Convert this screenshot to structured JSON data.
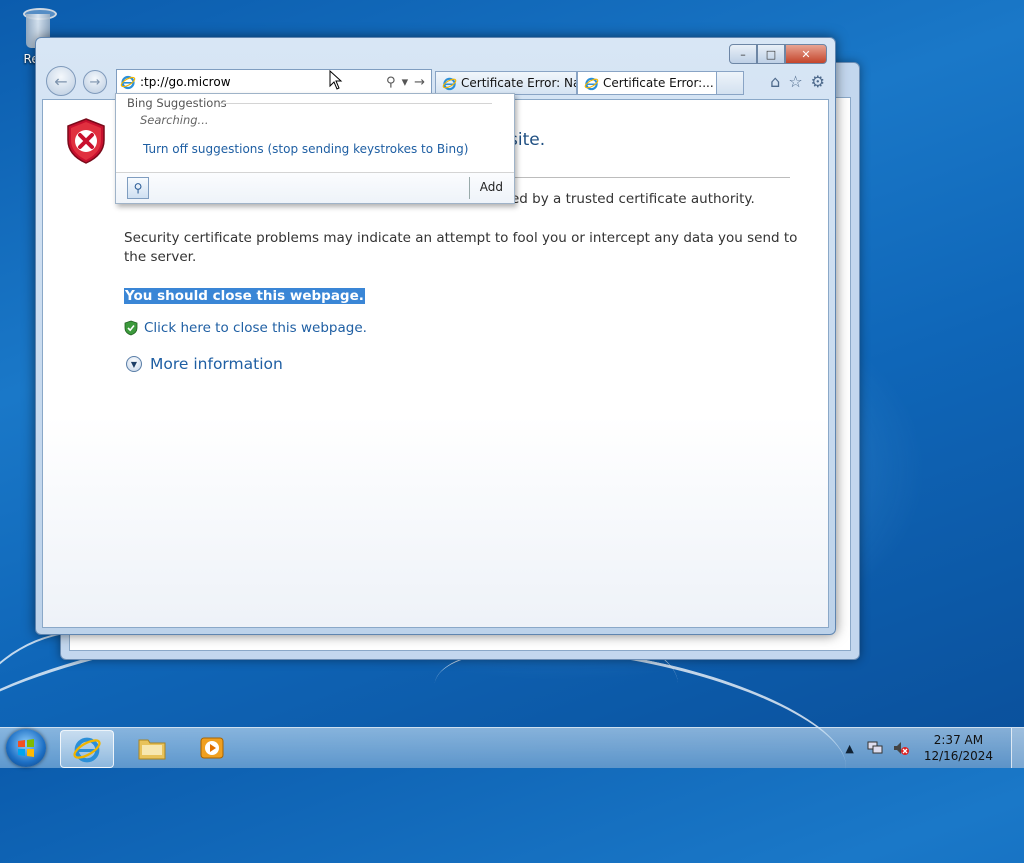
{
  "desktop": {
    "recycle_bin_label": "Recy"
  },
  "browser": {
    "address_url": ":tp://go.microw",
    "tabs": [
      {
        "label": "Certificate Error: Na...",
        "active": false
      },
      {
        "label": "Certificate Error:...",
        "active": true
      }
    ],
    "window_controls": {
      "minimize": "–",
      "maximize": "□",
      "close": "✕"
    },
    "nav": {
      "back": "←",
      "forward": "→"
    },
    "address_tools": {
      "search": "⚲",
      "dropdown": "▾",
      "go": "→"
    },
    "toolbar_icons": {
      "home": "⌂",
      "favorites": "☆",
      "tools": "⚙"
    }
  },
  "page": {
    "header_fragment": "site.",
    "line1_fragment": "ed by a trusted certificate authority.",
    "paragraph": "Security certificate problems may indicate an attempt to fool you or intercept any data you send to the server.",
    "warning": "You should close this webpage.",
    "close_link": "Click here to close this webpage.",
    "more_info": "More information"
  },
  "suggestions": {
    "title": "Bing Suggestions",
    "status": "Searching...",
    "turn_off": "Turn off suggestions (stop sending keystrokes to Bing)",
    "add_label": "Add"
  },
  "taskbar": {
    "time": "2:37 AM",
    "date": "12/16/2024"
  },
  "colors": {
    "link": "#1f5fa3",
    "highlight": "#3a86d6",
    "shield_red": "#c8102e"
  }
}
